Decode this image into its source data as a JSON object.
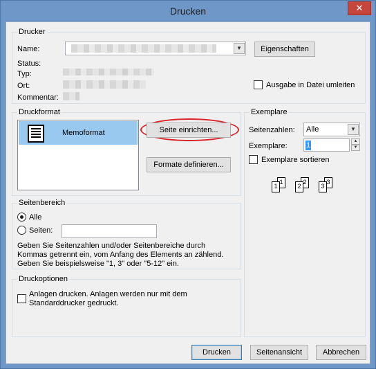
{
  "window": {
    "title": "Drucken",
    "close_label": "✕"
  },
  "printer": {
    "group_label": "Drucker",
    "name_label": "Name:",
    "properties_button": "Eigenschaften",
    "status_label": "Status:",
    "type_label": "Typ:",
    "location_label": "Ort:",
    "comment_label": "Kommentar:",
    "print_to_file_label": "Ausgabe in Datei umleiten"
  },
  "print_style": {
    "group_label": "Druckformat",
    "styles": [
      "Memoformat"
    ],
    "page_setup_button": "Seite einrichten...",
    "define_styles_button": "Formate definieren..."
  },
  "copies": {
    "group_label": "Exemplare",
    "pages_label": "Seitenzahlen:",
    "pages_value": "Alle",
    "copies_label": "Exemplare:",
    "copies_value": "1",
    "collate_label": "Exemplare sortieren",
    "collate_pages": [
      "1",
      "1",
      "2",
      "2",
      "3",
      "3"
    ]
  },
  "page_range": {
    "group_label": "Seitenbereich",
    "all_label": "Alle",
    "pages_label": "Seiten:",
    "pages_value": "",
    "help_line1": "Geben Sie Seitenzahlen und/oder Seitenbereiche durch",
    "help_line2": "Kommas getrennt ein, vom Anfang des Elements an zählend.",
    "help_line3": "Geben Sie beispielsweise \"1, 3\" oder \"5-12\" ein."
  },
  "print_options": {
    "group_label": "Druckoptionen",
    "attachments_line1": "Anlagen drucken. Anlagen werden nur mit dem",
    "attachments_line2": "Standarddrucker gedruckt."
  },
  "footer": {
    "print_button": "Drucken",
    "preview_button": "Seitenansicht",
    "cancel_button": "Abbrechen"
  },
  "colors": {
    "title_bar": "#6f98c8",
    "close_button": "#c7463b",
    "selection": "#99c9ef",
    "highlight_oval": "#d9252a"
  }
}
